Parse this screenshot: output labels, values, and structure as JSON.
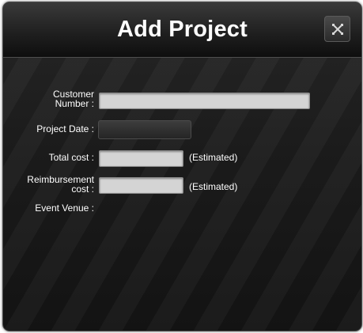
{
  "dialog": {
    "title": "Add Project",
    "close_icon": "close-x-icon"
  },
  "form": {
    "customer_number": {
      "label_line1": "Customer",
      "label_line2": "Number :",
      "value": ""
    },
    "project_date": {
      "label": "Project Date :",
      "value": ""
    },
    "total_cost": {
      "label": "Total cost :",
      "value": "",
      "note": "(Estimated)"
    },
    "reimbursement_cost": {
      "label_line1": "Reimbursement",
      "label_line2": "cost :",
      "value": "",
      "note": "(Estimated)"
    },
    "event_venue": {
      "label": "Event Venue :"
    }
  }
}
